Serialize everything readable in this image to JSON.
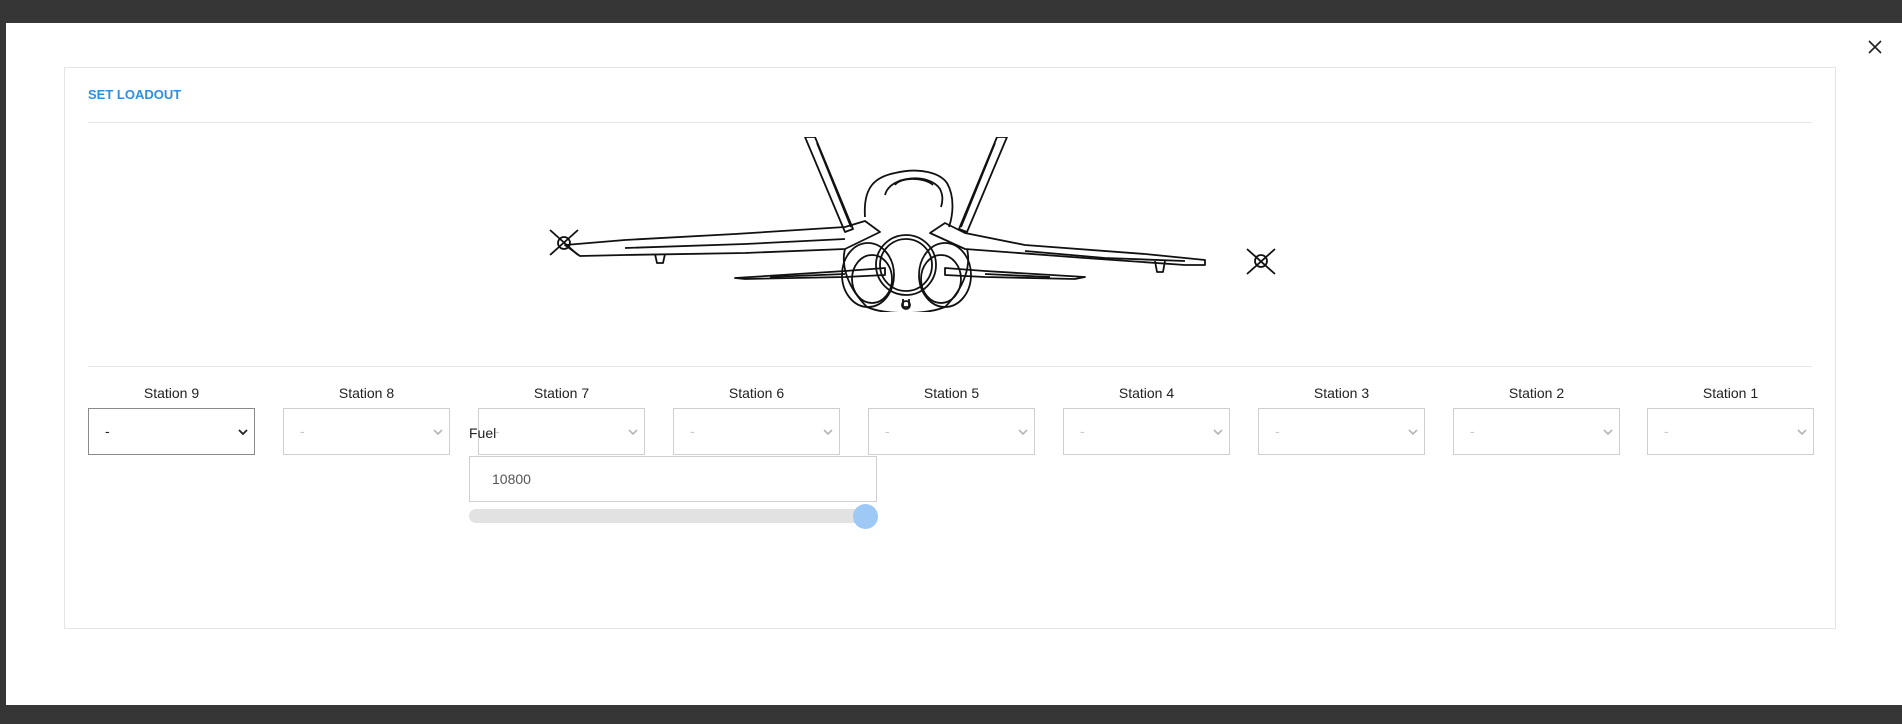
{
  "dialog": {
    "title": "SET LOADOUT",
    "close_icon": "close-icon"
  },
  "aircraft": {
    "icon": "fighter-jet-front-view"
  },
  "stations": [
    {
      "label": "Station 9",
      "value": "-",
      "enabled": true
    },
    {
      "label": "Station 8",
      "value": "-",
      "enabled": false
    },
    {
      "label": "Station 7",
      "value": "-",
      "enabled": false
    },
    {
      "label": "Station 6",
      "value": "-",
      "enabled": false
    },
    {
      "label": "Station 5",
      "value": "-",
      "enabled": false
    },
    {
      "label": "Station 4",
      "value": "-",
      "enabled": false
    },
    {
      "label": "Station 3",
      "value": "-",
      "enabled": false
    },
    {
      "label": "Station 2",
      "value": "-",
      "enabled": false
    },
    {
      "label": "Station 1",
      "value": "-",
      "enabled": false
    }
  ],
  "fuel": {
    "label": "Fuel",
    "value": "10800",
    "slider_fraction": 1.0
  },
  "colors": {
    "accent": "#2c8fe6",
    "slider_thumb": "#9ec9f7",
    "backdrop": "#363636"
  }
}
